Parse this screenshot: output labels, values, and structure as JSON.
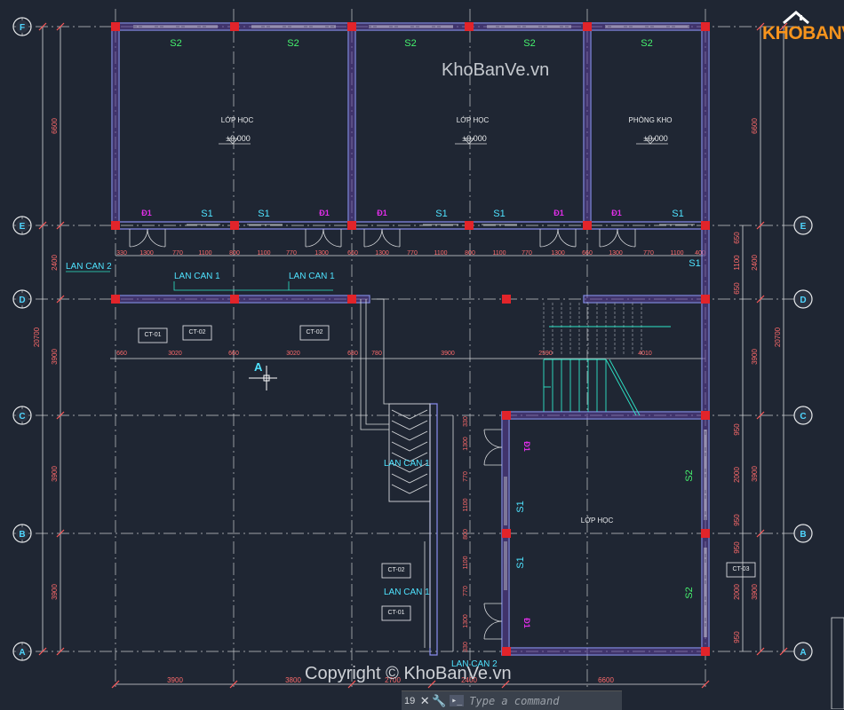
{
  "watermark": {
    "top": "KhoBanVe.vn",
    "bottom": "Copyright © KhoBanVe.vn"
  },
  "logo": {
    "text_a": "KHO",
    "text_b": "BANVE"
  },
  "grid_axes": [
    "F",
    "E",
    "D",
    "C",
    "B",
    "A"
  ],
  "rooms": {
    "room1": "LỚP HỌC",
    "room2": "LỚP HỌC",
    "room3": "PHÒNG KHO",
    "room4": "LỚP HỌC",
    "level": "±0.000"
  },
  "windows": {
    "s2": "S2",
    "s1": "S1",
    "d1": "Đ1"
  },
  "balcony": {
    "lan_can_1": "LAN CAN 1",
    "lan_can_2": "LAN CAN 2"
  },
  "column_tags": {
    "ct01": "CT-01",
    "ct02": "CT-02",
    "ct03": "CT-03"
  },
  "section_mark": "A",
  "dims": {
    "left_6600": "6600",
    "left_2400": "2400",
    "left_20700": "20700",
    "left_3900": "3900",
    "right_6600": "6600",
    "right_2400": "2400",
    "right_20700": "20700",
    "right_3900": "3900",
    "d1300": "1300",
    "d770": "770",
    "d1100": "1100",
    "d800": "800",
    "d660": "660",
    "d650": "650",
    "d950": "950",
    "d2000": "2000",
    "d2400": "2400",
    "d2700": "2700",
    "d2590": "2590",
    "d4010": "4010",
    "d3020": "3020",
    "d660b": "660",
    "d680": "680",
    "d780": "780",
    "d3900": "3900",
    "d400": "400",
    "d330": "330",
    "d6600": "6600",
    "d3800": "3800"
  },
  "command": {
    "line_no": "19",
    "close_label": "✕",
    "wrench_label": "🔧",
    "prompt_label": "▸_",
    "placeholder": "Type a command"
  }
}
